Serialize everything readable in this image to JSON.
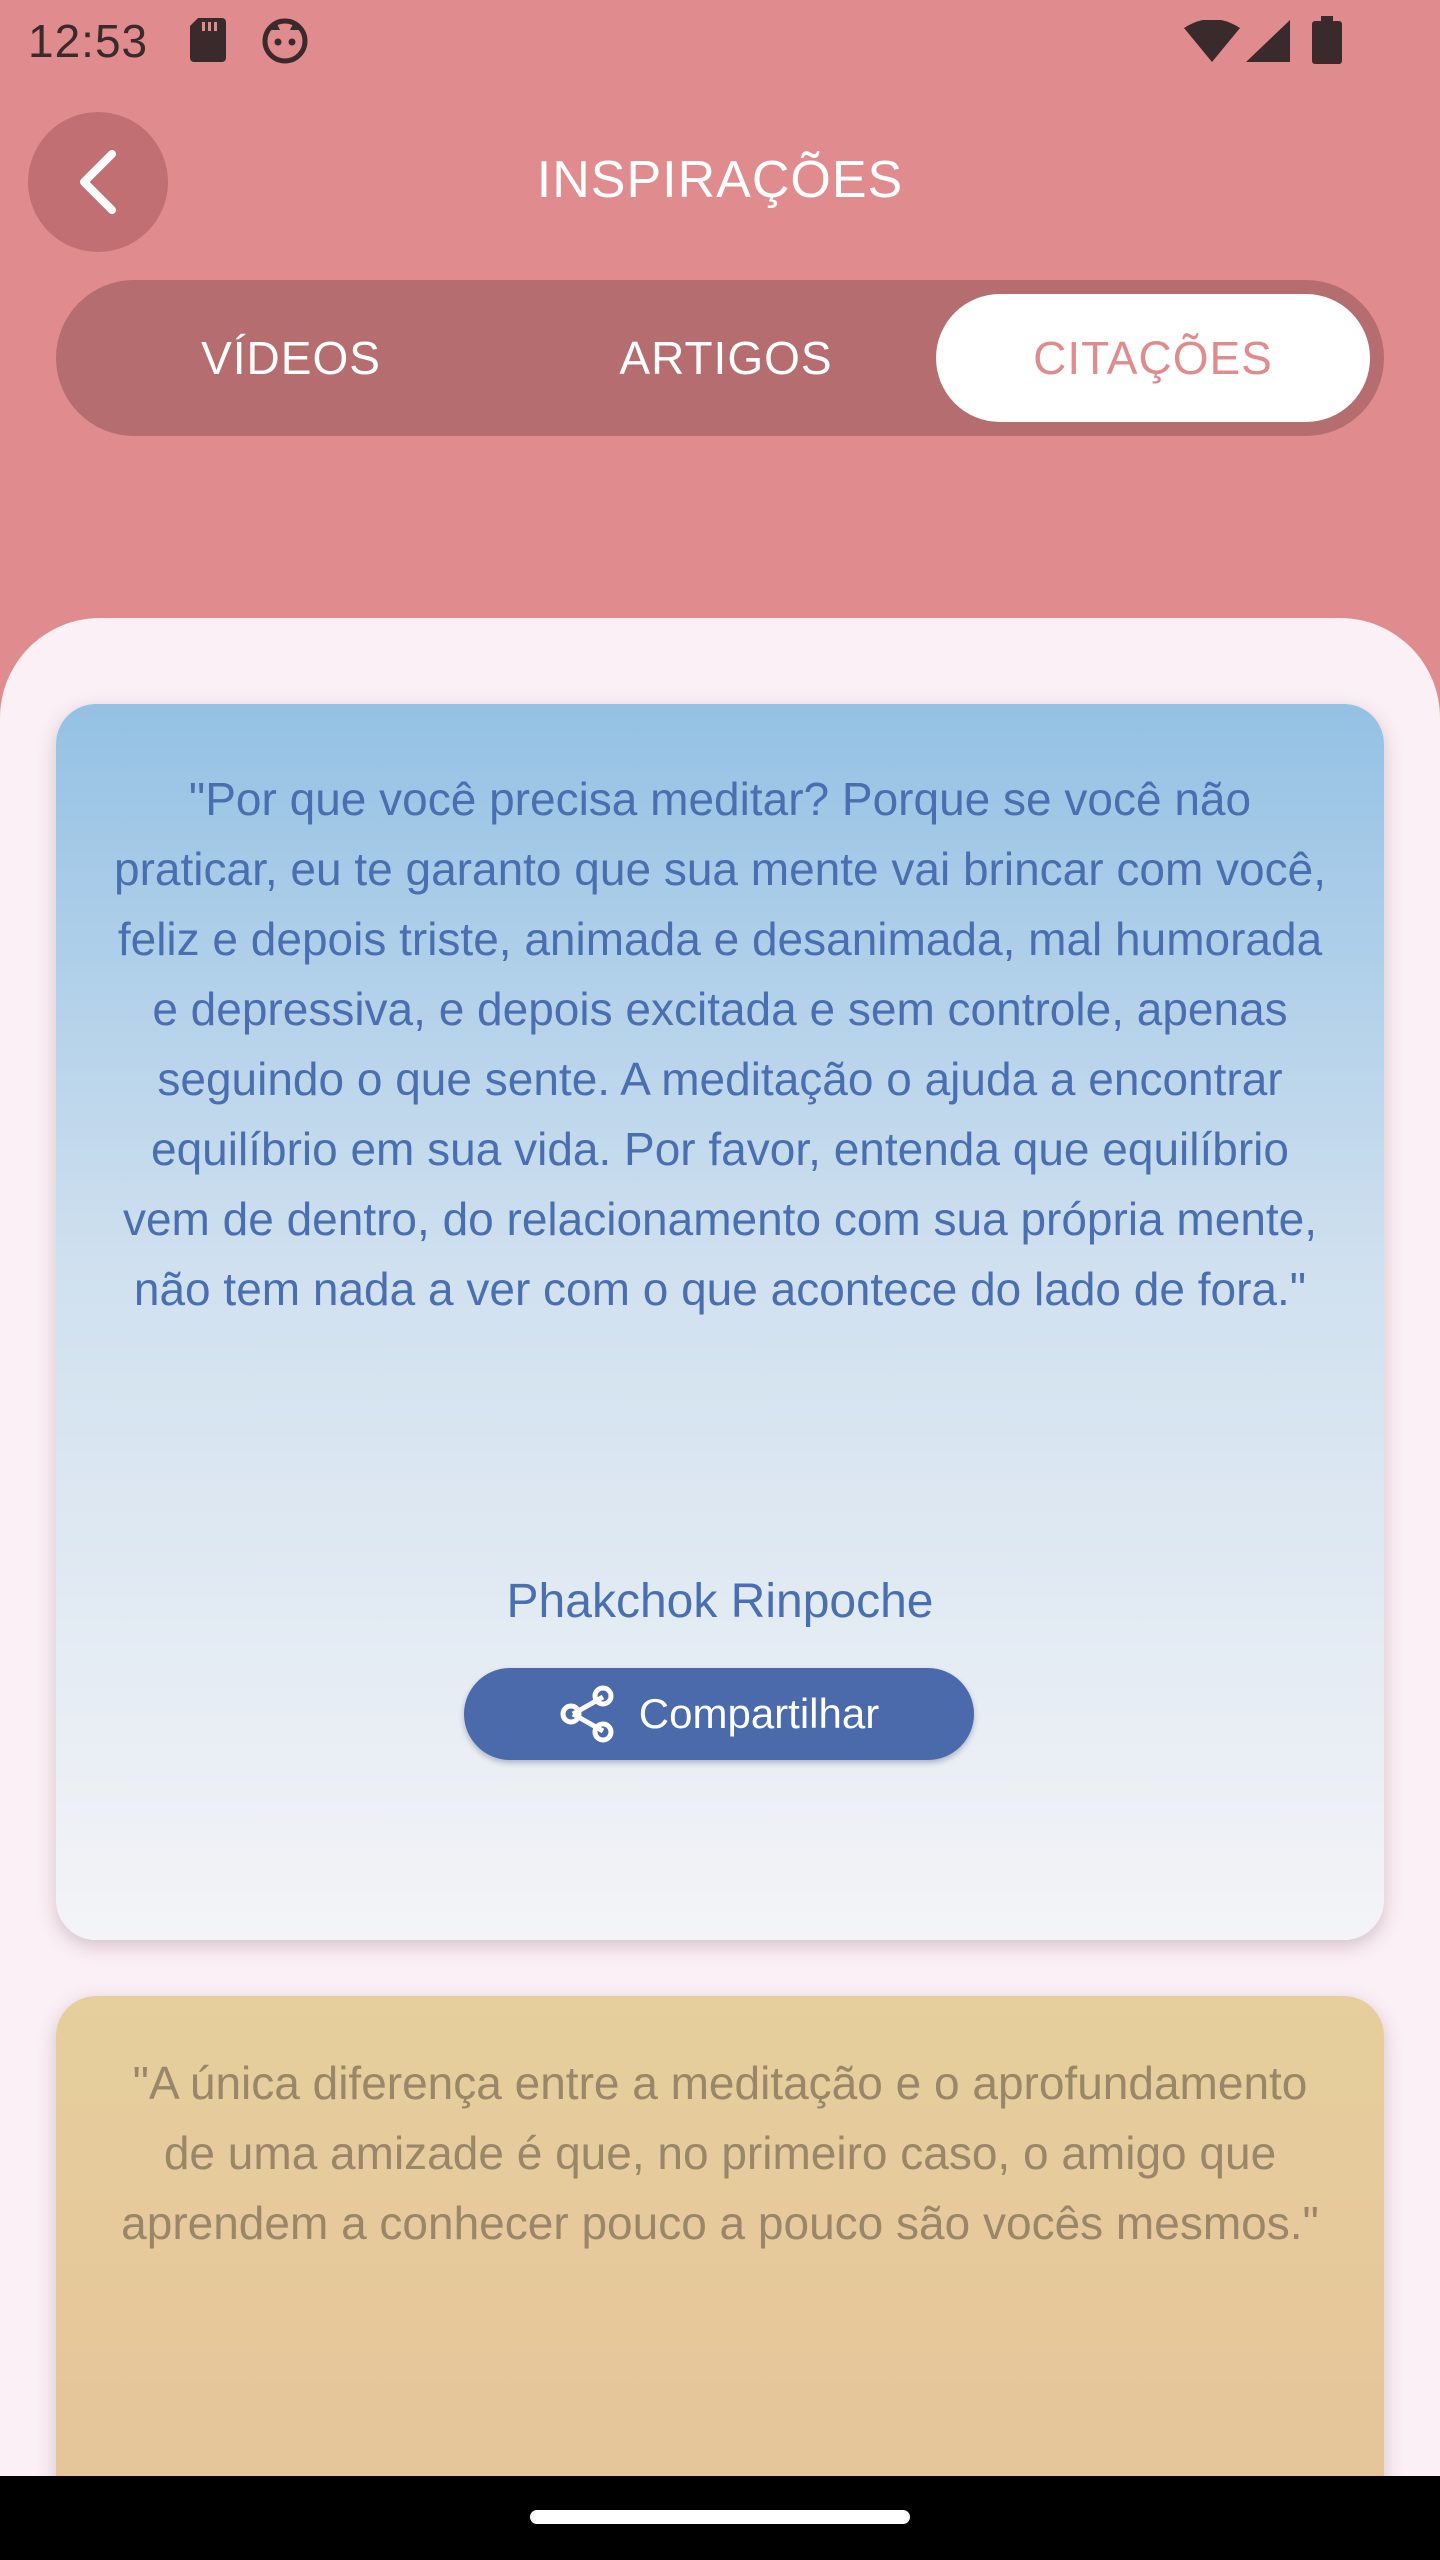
{
  "status_bar": {
    "time": "12:53",
    "left_icons": [
      "sd-card-icon",
      "notification-face-icon"
    ],
    "right_icons": [
      "wifi-icon",
      "cell-signal-icon",
      "battery-icon"
    ]
  },
  "header": {
    "title": "INSPIRAÇÕES",
    "back_icon": "chevron-left-icon"
  },
  "tabs": [
    {
      "label": "VÍDEOS",
      "selected": false
    },
    {
      "label": "ARTIGOS",
      "selected": false
    },
    {
      "label": "CITAÇÕES",
      "selected": true
    }
  ],
  "quotes": [
    {
      "text": "\"Por que você precisa meditar? Porque se você não praticar, eu te garanto que sua mente vai brincar com você, feliz e depois triste, animada e desanimada, mal humorada e depressiva, e depois excitada e sem controle, apenas seguindo o que sente. A meditação o ajuda a encontrar equilíbrio em sua vida. Por favor, entenda que equilíbrio vem de dentro, do relacionamento com sua própria mente, não tem nada a ver com o que acontece do lado de fora.\"",
      "author": "Phakchok Rinpoche",
      "share_label": "Compartilhar",
      "share_icon": "share-icon",
      "color_top": "#94c1e4",
      "text_color": "#4a6fb0"
    },
    {
      "text": "\"A única diferença entre a meditação e o aprofundamento de uma amizade é que, no primeiro caso, o amigo que aprendem a conhecer pouco a pouco são vocês mesmos.\"",
      "color_top": "#e6cf9c",
      "text_color": "#9a8668"
    }
  ],
  "colors": {
    "header_bg": "#e08c8f",
    "tab_bar_bg": "#b56d6f",
    "content_bg": "#fbf0f5",
    "share_button_bg": "#4a6aab"
  }
}
